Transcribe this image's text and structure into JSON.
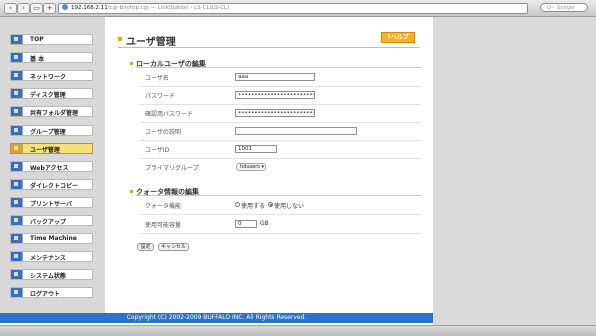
{
  "browser": {
    "url_host": "192.168.2.11",
    "url_rest": "/cgi-bin/top.cgi — LinkStation - LS-CL(LS-CL)",
    "search_placeholder": "Q~ Google"
  },
  "sidebar": {
    "items": [
      {
        "label": "TOP",
        "icon": "top-icon"
      },
      {
        "label": "基 本",
        "icon": "basic-settings-icon"
      },
      {
        "label": "ネットワーク",
        "icon": "network-icon"
      },
      {
        "label": "ディスク管理",
        "icon": "disk-icon"
      },
      {
        "label": "共有フォルダ管理",
        "icon": "shared-folder-icon"
      },
      {
        "label": "グループ管理",
        "icon": "group-icon"
      },
      {
        "label": "ユーザ管理",
        "icon": "user-icon"
      },
      {
        "label": "Webアクセス",
        "icon": "web-access-icon"
      },
      {
        "label": "ダイレクトコピー",
        "icon": "direct-copy-icon"
      },
      {
        "label": "プリントサーバ",
        "icon": "printer-icon"
      },
      {
        "label": "バックアップ",
        "icon": "backup-icon"
      },
      {
        "label": "Time Machine",
        "icon": "time-machine-icon"
      },
      {
        "label": "メンテナンス",
        "icon": "maintenance-icon"
      },
      {
        "label": "システム状態",
        "icon": "system-status-icon"
      },
      {
        "label": "ログアウト",
        "icon": "logout-icon"
      }
    ],
    "active_label": "ユーザ管理"
  },
  "main": {
    "title": "ユーザ管理",
    "help_label": "?ヘルプ",
    "local_section": {
      "heading": "ローカルユーザの編集",
      "username_label": "ユーザ名",
      "username_value": "aaa",
      "password_label": "パスワード",
      "password_value": "••••••••••••••••••••••••",
      "confirm_label": "確認用パスワード",
      "confirm_value": "••••••••••••••••••••••••",
      "description_label": "ユーザの説明",
      "description_value": "",
      "uid_label": "ユーザID",
      "uid_value": "1001",
      "group_label": "プライマリグループ",
      "group_value": "hdusers"
    },
    "quota_section": {
      "heading": "クォータ情報の編集",
      "quota_label": "クォータ機能",
      "use_label": "使用する",
      "nouse_label": "使用しない",
      "selected": "使用しない",
      "capacity_label": "使用可能容量",
      "capacity_value": "0",
      "capacity_unit": "GB"
    },
    "buttons": {
      "save": "設定",
      "cancel": "キャンセル"
    }
  },
  "footer": {
    "copyright": "Copyright (C) 2002-2009 BUFFALO INC. All Rights Reserved."
  },
  "colors": {
    "footer_bar": "#2d72c9",
    "active_item": "#f6e07a",
    "help_button": "#f6b21b",
    "accent": "#e8a21c"
  }
}
